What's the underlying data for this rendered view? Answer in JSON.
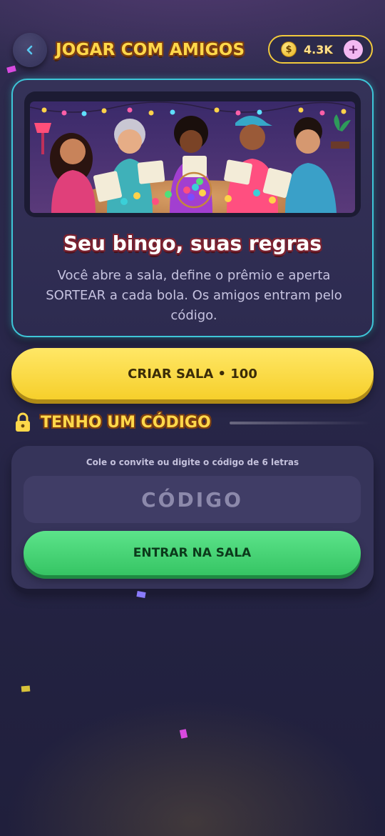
{
  "header": {
    "title": "JOGAR COM AMIGOS",
    "coins": "4.3K",
    "coin_symbol": "$",
    "plus_symbol": "+",
    "back_icon": "chevron-left-icon",
    "plus_icon": "plus-icon"
  },
  "hero": {
    "image": "friends-playing-bingo-illustration",
    "heading": "Seu bingo, suas regras",
    "description": "Você abre a sala, define o prêmio e aperta SORTEAR a cada bola. Os amigos entram pelo código."
  },
  "create_room": {
    "label": "CRIAR SALA • 100"
  },
  "join": {
    "section_title": "TENHO UM CÓDIGO",
    "lock_icon": "lock-icon",
    "hint": "Cole o convite ou digite o código de 6 letras",
    "code_placeholder": "CÓDIGO",
    "code_value": "",
    "enter_label": "ENTRAR NA SALA"
  },
  "colors": {
    "accent_yellow": "#ffd84a",
    "button_yellow": "#f6cf2b",
    "button_green": "#36c564",
    "card_border_cyan": "#3ec6d8",
    "background": "#29274a"
  }
}
